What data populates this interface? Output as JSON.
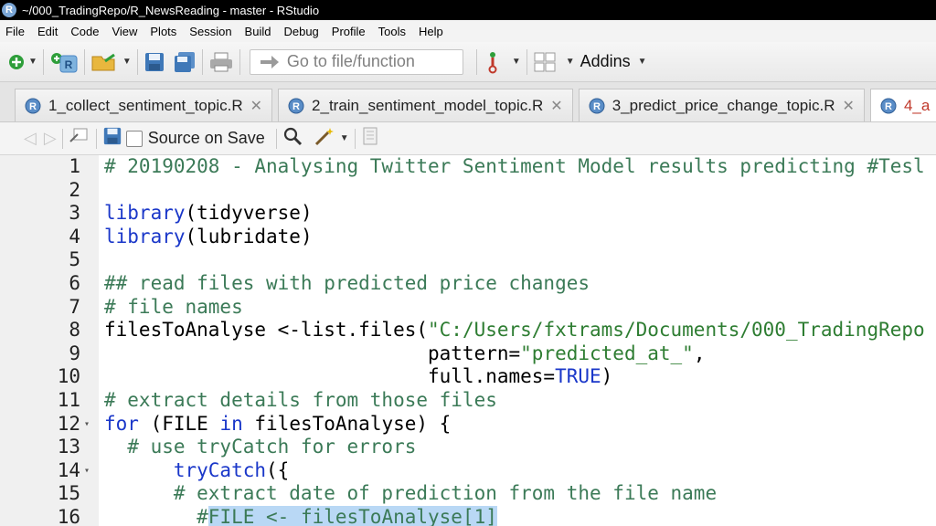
{
  "window": {
    "title": "~/000_TradingRepo/R_NewsReading - master - RStudio",
    "app_icon": "R"
  },
  "menu": [
    "File",
    "Edit",
    "Code",
    "View",
    "Plots",
    "Session",
    "Build",
    "Debug",
    "Profile",
    "Tools",
    "Help"
  ],
  "toolbar": {
    "goto_placeholder": "Go to file/function",
    "addins_label": "Addins",
    "icons": [
      "new-file-icon",
      "new-project-icon",
      "open-file-icon",
      "save-icon",
      "save-all-icon",
      "print-icon",
      "arrow-right-icon",
      "vcs-icon",
      "grid-icon"
    ]
  },
  "tabs": [
    {
      "label": "1_collect_sentiment_topic.R",
      "close": "✕",
      "active": false
    },
    {
      "label": "2_train_sentiment_model_topic.R",
      "close": "✕",
      "active": false
    },
    {
      "label": "3_predict_price_change_topic.R",
      "close": "✕",
      "active": false
    },
    {
      "label": "4_a",
      "close": "",
      "active": true
    }
  ],
  "editor_toolbar": {
    "source_on_save": "Source on Save"
  },
  "colors": {
    "comment": "#3b7a57",
    "keyword": "#1a37c9",
    "string": "#2e7d32",
    "selection": "#b9d8f5"
  },
  "code_lines": [
    {
      "n": "1",
      "fold": "",
      "parts": [
        {
          "t": "# 20190208 - Analysing Twitter Sentiment Model results predicting #Tesl",
          "c": "comment"
        }
      ]
    },
    {
      "n": "2",
      "fold": "",
      "parts": []
    },
    {
      "n": "3",
      "fold": "",
      "parts": [
        {
          "t": "library",
          "c": "kw"
        },
        {
          "t": "(tidyverse)",
          "c": ""
        }
      ]
    },
    {
      "n": "4",
      "fold": "",
      "parts": [
        {
          "t": "library",
          "c": "kw"
        },
        {
          "t": "(lubridate)",
          "c": ""
        }
      ]
    },
    {
      "n": "5",
      "fold": "",
      "parts": []
    },
    {
      "n": "6",
      "fold": "",
      "parts": [
        {
          "t": "## read files with predicted price changes",
          "c": "comment"
        }
      ]
    },
    {
      "n": "7",
      "fold": "",
      "parts": [
        {
          "t": "# file names",
          "c": "comment"
        }
      ]
    },
    {
      "n": "8",
      "fold": "",
      "parts": [
        {
          "t": "filesToAnalyse <-list.files(",
          "c": ""
        },
        {
          "t": "\"C:/Users/fxtrams/Documents/000_TradingRepo",
          "c": "str"
        }
      ]
    },
    {
      "n": "9",
      "fold": "",
      "parts": [
        {
          "t": "                            pattern=",
          "c": ""
        },
        {
          "t": "\"predicted_at_\"",
          "c": "str"
        },
        {
          "t": ",",
          "c": ""
        }
      ]
    },
    {
      "n": "10",
      "fold": "",
      "parts": [
        {
          "t": "                            full.names=",
          "c": ""
        },
        {
          "t": "TRUE",
          "c": "kw"
        },
        {
          "t": ")",
          "c": ""
        }
      ]
    },
    {
      "n": "11",
      "fold": "",
      "parts": [
        {
          "t": "# extract details from those files",
          "c": "comment"
        }
      ]
    },
    {
      "n": "12",
      "fold": "▾",
      "parts": [
        {
          "t": "for",
          "c": "kw"
        },
        {
          "t": " (FILE ",
          "c": ""
        },
        {
          "t": "in",
          "c": "kw"
        },
        {
          "t": " filesToAnalyse) {",
          "c": ""
        }
      ]
    },
    {
      "n": "13",
      "fold": "",
      "parts": [
        {
          "t": "  # use tryCatch for errors",
          "c": "comment"
        }
      ]
    },
    {
      "n": "14",
      "fold": "▾",
      "parts": [
        {
          "t": "      ",
          "c": ""
        },
        {
          "t": "tryCatch",
          "c": "kw"
        },
        {
          "t": "({",
          "c": ""
        }
      ]
    },
    {
      "n": "15",
      "fold": "",
      "parts": [
        {
          "t": "      # extract date of prediction from the file name",
          "c": "comment"
        }
      ]
    },
    {
      "n": "16",
      "fold": "",
      "parts": [
        {
          "t": "        #",
          "c": "comment"
        },
        {
          "t": "FILE <- filesToAnalyse[1]",
          "c": "comment hl"
        }
      ]
    }
  ]
}
